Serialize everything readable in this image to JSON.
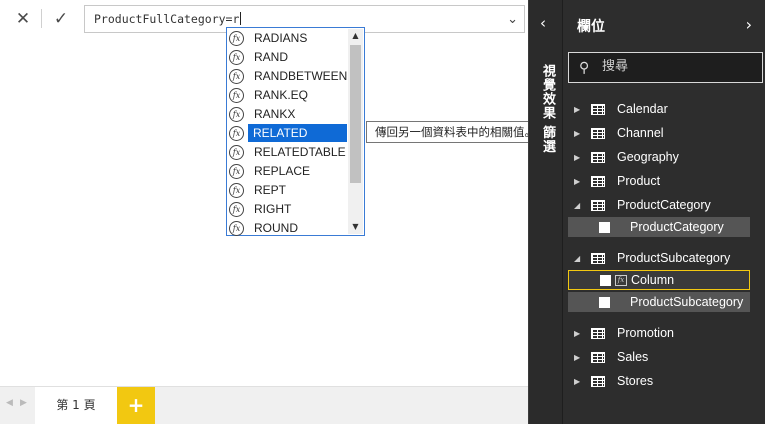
{
  "formula_bar": {
    "cancel_icon": "✕",
    "commit_icon": "✓",
    "text": "ProductFullCategory=r",
    "expand_icon": "⌄"
  },
  "autocomplete": {
    "icon_text": "fx",
    "items": [
      {
        "label": "RADIANS"
      },
      {
        "label": "RAND"
      },
      {
        "label": "RANDBETWEEN"
      },
      {
        "label": "RANK.EQ"
      },
      {
        "label": "RANKX"
      },
      {
        "label": "RELATED",
        "selected": true
      },
      {
        "label": "RELATEDTABLE"
      },
      {
        "label": "REPLACE"
      },
      {
        "label": "REPT"
      },
      {
        "label": "RIGHT"
      },
      {
        "label": "ROUND"
      }
    ],
    "scroll_up": "▲",
    "scroll_down": "▼",
    "tooltip": "傳回另一個資料表中的相關值。"
  },
  "pages": {
    "prev_icon": "◀",
    "next_icon": "▶",
    "tab_label": "第 1 頁",
    "add_label": "+"
  },
  "visualizations": {
    "collapse_icon": "‹",
    "title": "視覺效果 篩選"
  },
  "fields": {
    "title": "欄位",
    "next_icon": "›",
    "search_icon": "⚲",
    "search_placeholder": "搜尋",
    "tables": [
      {
        "name": "Calendar",
        "expanded": false
      },
      {
        "name": "Channel",
        "expanded": false
      },
      {
        "name": "Geography",
        "expanded": false
      },
      {
        "name": "Product",
        "expanded": false
      },
      {
        "name": "ProductCategory",
        "expanded": true,
        "fields": [
          "ProductCategory"
        ]
      },
      {
        "name": "ProductSubcategory",
        "expanded": true,
        "fields": [
          "Column",
          "ProductSubcategory"
        ]
      },
      {
        "name": "Promotion",
        "expanded": false
      },
      {
        "name": "Sales",
        "expanded": false
      },
      {
        "name": "Stores",
        "expanded": false
      }
    ],
    "expanded_icon": "◢",
    "collapsed_icon": "▶",
    "calc_icon_text": "fx",
    "highlight_color": "#f2c811"
  }
}
